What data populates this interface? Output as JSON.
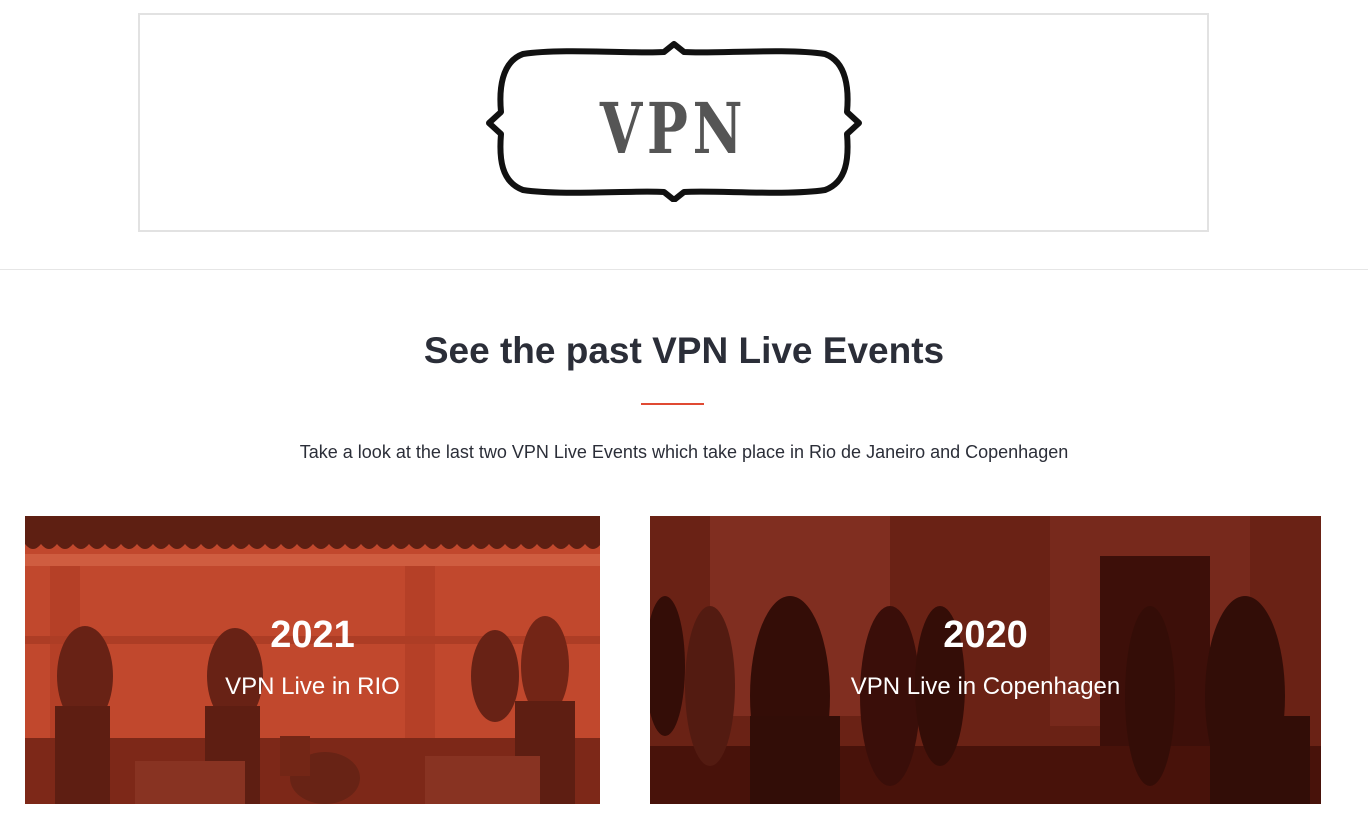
{
  "header": {
    "logo_text": "VPN"
  },
  "section": {
    "title": "See the past VPN Live Events",
    "subtitle": "Take a look at the last two VPN Live Events which take place in Rio de Janeiro and Copenhagen"
  },
  "events": [
    {
      "year": "2021",
      "name": "VPN Live in RIO"
    },
    {
      "year": "2020",
      "name": "VPN Live in Copenhagen"
    }
  ],
  "colors": {
    "accent": "#e04a33",
    "text": "#2b2e38",
    "overlay_rio": "#c0442a",
    "overlay_cph": "#6b1e12"
  }
}
